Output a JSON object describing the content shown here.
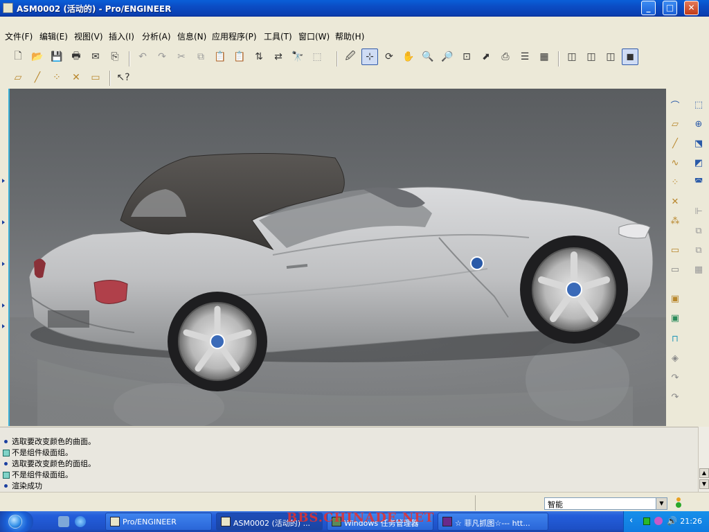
{
  "window": {
    "title": "ASM0002 (活动的) - Pro/ENGINEER",
    "controls": {
      "minimize": "_",
      "maximize": "□",
      "close": "✕"
    }
  },
  "menu": {
    "items": [
      "文件(F)",
      "编辑(E)",
      "视图(V)",
      "插入(I)",
      "分析(A)",
      "信息(N)",
      "应用程序(P)",
      "工具(T)",
      "窗口(W)",
      "帮助(H)"
    ]
  },
  "toolbar1": {
    "icons": [
      "new-icon",
      "open-icon",
      "save-icon",
      "print-icon",
      "send-email-icon",
      "send-link-icon",
      "undo-icon",
      "redo-icon",
      "cut-icon",
      "copy-icon",
      "paste-icon",
      "paste-special-icon",
      "regenerate-icon",
      "regen-manager-icon",
      "find-icon",
      "select-box-icon",
      "repaint-icon",
      "spin-center-icon",
      "orient-mode-icon",
      "pan-icon",
      "zoom-in-icon",
      "zoom-out-icon",
      "refit-icon",
      "reorient-icon",
      "named-view-icon",
      "layers-icon",
      "view-manager-icon",
      "wireframe-icon",
      "hidden-line-icon",
      "no-hidden-icon",
      "shading-icon"
    ]
  },
  "toolbar2": {
    "icons": [
      "datum-planes-icon",
      "datum-axes-icon",
      "datum-points-icon",
      "datum-csys-icon",
      "annotation-icon",
      "context-help-icon"
    ]
  },
  "right_toolbar": {
    "col1": [
      "sketch-tool-icon",
      "plane-tool-icon",
      "axis-tool-icon",
      "curve-tool-icon",
      "point-tool-icon",
      "point-offset-icon",
      "csys-tool-icon",
      "annotation-feature-icon",
      "analysis-feature-icon",
      "assemble-icon",
      "create-component-icon",
      "pattern-icon",
      "mirror-icon",
      "hole-icon",
      "rotate-icon",
      "rotate-alt-icon"
    ],
    "col2": [
      "extrude-icon",
      "revolve-icon",
      "sweep-icon",
      "blend-icon",
      "surface-icon",
      "symmetric-icon",
      "offset-icon",
      "copy-feature-icon",
      "grid-icon"
    ]
  },
  "messages": [
    {
      "type": "bullet",
      "text": "选取要改变颜色的曲面。"
    },
    {
      "type": "warning",
      "text": "不是组件级面组。"
    },
    {
      "type": "bullet",
      "text": "选取要改变颜色的面组。"
    },
    {
      "type": "warning",
      "text": "不是组件级面组。"
    },
    {
      "type": "bullet",
      "text": "渲染成功"
    }
  ],
  "status": {
    "filter_value": "智能"
  },
  "taskbar": {
    "tasks": [
      {
        "label": "Pro/ENGINEER",
        "active": false
      },
      {
        "label": "ASM0002 (活动的) ...",
        "active": true
      },
      {
        "label": "Windows 任务管理器",
        "active": false
      },
      {
        "label": "☆ 菲凡抓图☆--- htt...",
        "active": false
      }
    ],
    "clock": "21:26",
    "watermark": "BBS.CHINADE.NET"
  },
  "colors": {
    "title_bar": "#0a4fc8",
    "graphics_bg": "#6a6d70",
    "car_body": "#c8c9cb",
    "soft_top": "#4a4745",
    "tail_light": "#b0404a"
  }
}
